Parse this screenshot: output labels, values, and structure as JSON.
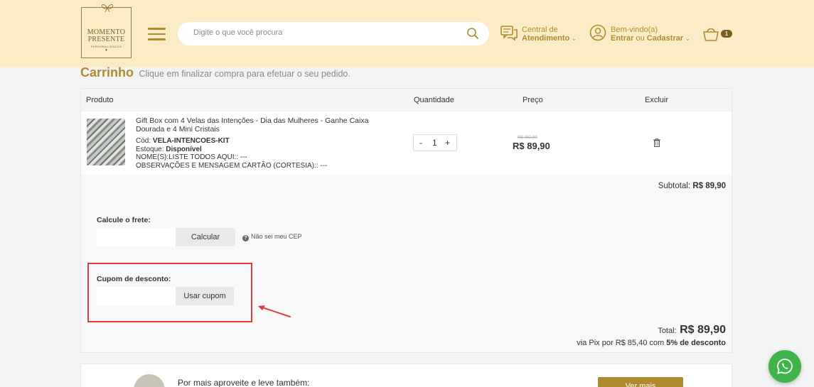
{
  "header": {
    "logo": {
      "line1": "MOMENTO",
      "line2": "PRESENTE",
      "line3": "PERSONALIZADOS",
      "line4": "♦"
    },
    "search": {
      "placeholder": "Digite o que você procura"
    },
    "support": {
      "line1": "Central de",
      "line2": "Atendimento"
    },
    "user": {
      "greeting": "Bem-vindo(a)",
      "login": "Entrar",
      "or": "ou",
      "register": "Cadastrar"
    },
    "cart": {
      "count": "1"
    },
    "colors": {
      "background": "#fbecc8",
      "accent": "#b08a2e"
    }
  },
  "page": {
    "title": "Carrinho",
    "subtitle": "Clique em finalizar compra para efetuar o seu pedido."
  },
  "table": {
    "headers": {
      "product": "Produto",
      "quantity": "Quantidade",
      "price": "Preço",
      "remove": "Excluir"
    }
  },
  "item": {
    "name": "Gift Box com 4 Velas das Intenções - Dia das Mulheres - Ganhe Caixa Dourada e 4 Mini Cristais",
    "code_label": "Cód:",
    "code": "VELA-INTENCOES-KIT",
    "stock_label": "Estoque:",
    "stock": "Disponível",
    "names_field": "NOME(S):LISTE TODOS AQUI:: ---",
    "notes_field": "OBSERVAÇÕES E MENSAGEM CARTÃO (CORTESIA):: ---",
    "qty_minus": "-",
    "qty": "1",
    "qty_plus": "+",
    "old_price": "R$ 162,90",
    "price": "R$ 89,90"
  },
  "subtotal": {
    "label": "Subtotal:",
    "value": "R$ 89,90"
  },
  "shipping": {
    "label": "Calcule o frete:",
    "button": "Calcular",
    "help": "Não sei meu CEP",
    "help_icon": "?"
  },
  "coupon": {
    "label": "Cupom de desconto:",
    "button": "Usar cupom"
  },
  "total": {
    "label": "Total:",
    "value": "R$ 89,90",
    "pix_prefix": "via Pix por",
    "pix_value": "R$ 85,40",
    "pix_with": "com",
    "pix_discount": "5% de desconto"
  },
  "upsell": {
    "text": "Por mais aproveite e leve também:",
    "button": "Ver mais"
  },
  "icons": [
    "menu-icon",
    "search-icon",
    "chat-icon",
    "user-icon",
    "basket-icon",
    "trash-icon",
    "help-icon",
    "whatsapp-icon",
    "arrow-annotation"
  ]
}
